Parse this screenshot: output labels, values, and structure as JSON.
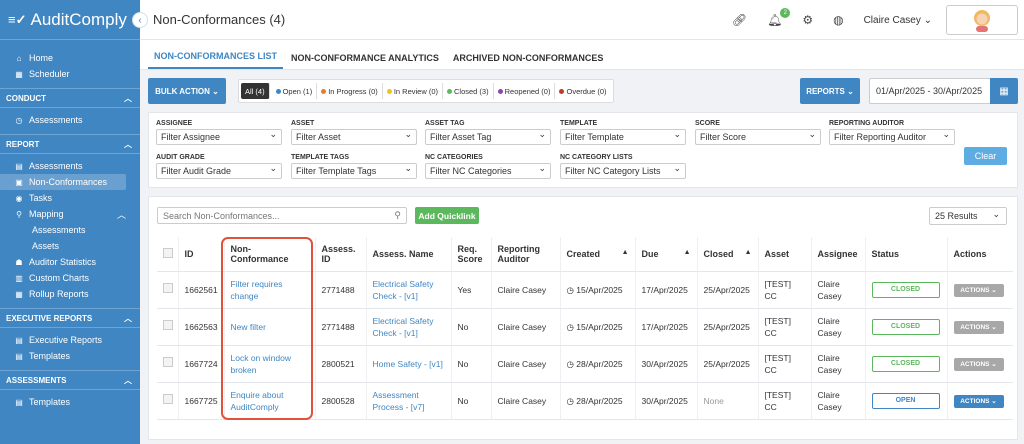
{
  "app": {
    "name": "AuditComply"
  },
  "sidebar": {
    "top_items": [
      {
        "label": "Home",
        "icon": "home-icon"
      },
      {
        "label": "Scheduler",
        "icon": "calendar-icon"
      }
    ],
    "sections": [
      {
        "title": "CONDUCT",
        "items": [
          {
            "label": "Assessments",
            "icon": "clock-icon"
          }
        ]
      },
      {
        "title": "REPORT",
        "items": [
          {
            "label": "Assessments",
            "icon": "list-icon"
          },
          {
            "label": "Non-Conformances",
            "icon": "document-icon"
          },
          {
            "label": "Tasks",
            "icon": "tasks-icon"
          },
          {
            "label": "Mapping",
            "icon": "map-marker-icon"
          },
          {
            "label": "Assessments",
            "icon": ""
          },
          {
            "label": "Assets",
            "icon": ""
          },
          {
            "label": "Auditor Statistics",
            "icon": "users-icon"
          },
          {
            "label": "Custom Charts",
            "icon": "chart-icon"
          },
          {
            "label": "Rollup Reports",
            "icon": "rollup-icon"
          }
        ]
      },
      {
        "title": "EXECUTIVE REPORTS",
        "items": [
          {
            "label": "Executive Reports",
            "icon": "report-icon"
          },
          {
            "label": "Templates",
            "icon": "template-icon"
          }
        ]
      },
      {
        "title": "ASSESSMENTS",
        "items": [
          {
            "label": "Templates",
            "icon": "template-icon"
          }
        ]
      }
    ]
  },
  "header": {
    "title": "Non-Conformances (4)",
    "notification_count": "2",
    "user_name": "Claire Casey"
  },
  "tabs": [
    "NON-CONFORMANCES LIST",
    "NON-CONFORMANCE ANALYTICS",
    "ARCHIVED NON-CONFORMANCES"
  ],
  "toolbar": {
    "bulk_action": "BULK ACTION",
    "status_filters": [
      {
        "label": "All (4)",
        "color": ""
      },
      {
        "label": "Open (1)",
        "color": "#3f86c3"
      },
      {
        "label": "In Progress (0)",
        "color": "#e67e22"
      },
      {
        "label": "In Review (0)",
        "color": "#f1c40f"
      },
      {
        "label": "Closed (3)",
        "color": "#5cb85c"
      },
      {
        "label": "Reopened (0)",
        "color": "#8e44ad"
      },
      {
        "label": "Overdue (0)",
        "color": "#c0392b"
      }
    ],
    "reports": "REPORTS",
    "date_range": "01/Apr/2025 - 30/Apr/2025"
  },
  "filters": {
    "groups": [
      {
        "label": "ASSIGNEE",
        "value": "Filter Assignee"
      },
      {
        "label": "ASSET",
        "value": "Filter Asset"
      },
      {
        "label": "ASSET TAG",
        "value": "Filter Asset Tag"
      },
      {
        "label": "TEMPLATE",
        "value": "Filter Template"
      },
      {
        "label": "SCORE",
        "value": "Filter Score"
      },
      {
        "label": "REPORTING AUDITOR",
        "value": "Filter Reporting Auditor"
      },
      {
        "label": "AUDIT GRADE",
        "value": "Filter Audit Grade"
      },
      {
        "label": "TEMPLATE TAGS",
        "value": "Filter Template Tags"
      },
      {
        "label": "NC CATEGORIES",
        "value": "Filter NC Categories"
      },
      {
        "label": "NC CATEGORY LISTS",
        "value": "Filter NC Category Lists"
      }
    ],
    "clear": "Clear"
  },
  "list": {
    "search_placeholder": "Search Non-Conformances...",
    "add_quicklink": "Add Quicklink",
    "results": "25 Results",
    "columns": [
      "ID",
      "Non-Conformance",
      "Assess. ID",
      "Assess. Name",
      "Req. Score",
      "Reporting Auditor",
      "Created",
      "Due",
      "Closed",
      "Asset",
      "Assignee",
      "Status",
      "Actions"
    ],
    "rows": [
      {
        "id": "1662561",
        "nc": "Filter requires change",
        "assess_id": "2771488",
        "assess_name": "Electrical Safety Check - [v1]",
        "req_score": "Yes",
        "auditor": "Claire Casey",
        "created": "15/Apr/2025",
        "due": "17/Apr/2025",
        "closed": "25/Apr/2025",
        "asset": "[TEST] CC",
        "assignee": "Claire Casey",
        "status": "CLOSED",
        "actions": "ACTIONS"
      },
      {
        "id": "1662563",
        "nc": "New filter",
        "assess_id": "2771488",
        "assess_name": "Electrical Safety Check - [v1]",
        "req_score": "No",
        "auditor": "Claire Casey",
        "created": "15/Apr/2025",
        "due": "17/Apr/2025",
        "closed": "25/Apr/2025",
        "asset": "[TEST] CC",
        "assignee": "Claire Casey",
        "status": "CLOSED",
        "actions": "ACTIONS"
      },
      {
        "id": "1667724",
        "nc": "Lock on window broken",
        "assess_id": "2800521",
        "assess_name": "Home Safety - [v1]",
        "req_score": "No",
        "auditor": "Claire Casey",
        "created": "28/Apr/2025",
        "due": "30/Apr/2025",
        "closed": "25/Apr/2025",
        "asset": "[TEST] CC",
        "assignee": "Claire Casey",
        "status": "CLOSED",
        "actions": "ACTIONS"
      },
      {
        "id": "1667725",
        "nc": "Enquire about AuditComply",
        "assess_id": "2800528",
        "assess_name": "Assessment Process - [v7]",
        "req_score": "No",
        "auditor": "Claire Casey",
        "created": "28/Apr/2025",
        "due": "30/Apr/2025",
        "closed": "None",
        "asset": "[TEST] CC",
        "assignee": "Claire Casey",
        "status": "OPEN",
        "actions": "ACTIONS"
      }
    ]
  }
}
